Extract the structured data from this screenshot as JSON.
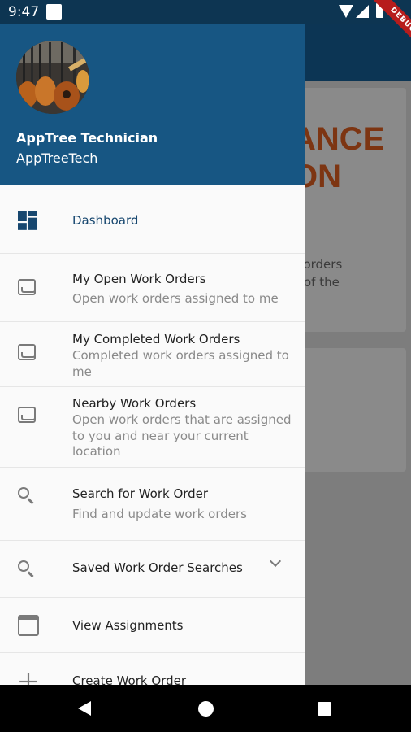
{
  "status_bar": {
    "time": "9:47",
    "debug_label": "DEBUG"
  },
  "background": {
    "title_lines": [
      "ANCE",
      "ON"
    ],
    "body_lines": [
      "k orders",
      "e of the"
    ]
  },
  "drawer": {
    "header": {
      "name": "AppTree Technician",
      "username": "AppTreeTech"
    },
    "items": [
      {
        "icon": "dashboard-icon",
        "title": "Dashboard",
        "subtitle": ""
      },
      {
        "icon": "inbox-icon",
        "title": "My Open Work Orders",
        "subtitle": "Open work orders assigned to me"
      },
      {
        "icon": "inbox-icon",
        "title": "My Completed Work Orders",
        "subtitle": "Completed work orders assigned to me"
      },
      {
        "icon": "inbox-icon",
        "title": "Nearby Work Orders",
        "subtitle": "Open work orders that are assigned to you and near your current location"
      },
      {
        "icon": "search-icon",
        "title": "Search for Work Order",
        "subtitle": "Find and update work orders"
      },
      {
        "icon": "search-icon",
        "title": "Saved Work Order Searches",
        "subtitle": ""
      },
      {
        "icon": "calendar-icon",
        "title": "View Assignments",
        "subtitle": ""
      },
      {
        "icon": "plus-icon",
        "title": "Create Work Order",
        "subtitle": ""
      }
    ]
  },
  "colors": {
    "header": "#175683",
    "status_bar": "#0d3552",
    "accent_text": "#17476f"
  }
}
